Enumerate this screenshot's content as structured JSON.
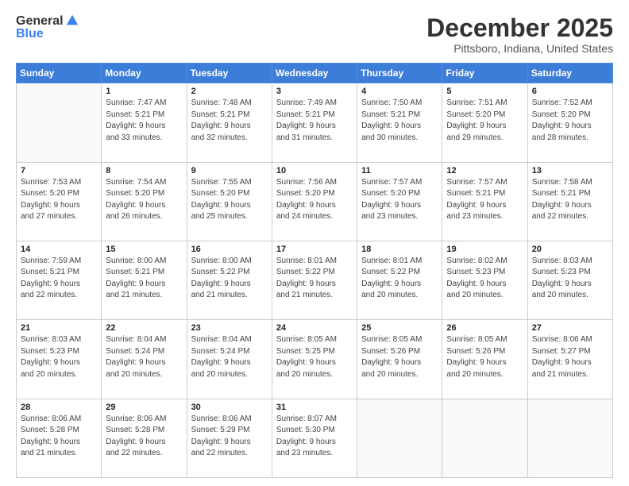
{
  "header": {
    "logo_general": "General",
    "logo_blue": "Blue",
    "month": "December 2025",
    "location": "Pittsboro, Indiana, United States"
  },
  "days_of_week": [
    "Sunday",
    "Monday",
    "Tuesday",
    "Wednesday",
    "Thursday",
    "Friday",
    "Saturday"
  ],
  "weeks": [
    [
      {
        "day": "",
        "info": ""
      },
      {
        "day": "1",
        "info": "Sunrise: 7:47 AM\nSunset: 5:21 PM\nDaylight: 9 hours\nand 33 minutes."
      },
      {
        "day": "2",
        "info": "Sunrise: 7:48 AM\nSunset: 5:21 PM\nDaylight: 9 hours\nand 32 minutes."
      },
      {
        "day": "3",
        "info": "Sunrise: 7:49 AM\nSunset: 5:21 PM\nDaylight: 9 hours\nand 31 minutes."
      },
      {
        "day": "4",
        "info": "Sunrise: 7:50 AM\nSunset: 5:21 PM\nDaylight: 9 hours\nand 30 minutes."
      },
      {
        "day": "5",
        "info": "Sunrise: 7:51 AM\nSunset: 5:20 PM\nDaylight: 9 hours\nand 29 minutes."
      },
      {
        "day": "6",
        "info": "Sunrise: 7:52 AM\nSunset: 5:20 PM\nDaylight: 9 hours\nand 28 minutes."
      }
    ],
    [
      {
        "day": "7",
        "info": "Sunrise: 7:53 AM\nSunset: 5:20 PM\nDaylight: 9 hours\nand 27 minutes."
      },
      {
        "day": "8",
        "info": "Sunrise: 7:54 AM\nSunset: 5:20 PM\nDaylight: 9 hours\nand 26 minutes."
      },
      {
        "day": "9",
        "info": "Sunrise: 7:55 AM\nSunset: 5:20 PM\nDaylight: 9 hours\nand 25 minutes."
      },
      {
        "day": "10",
        "info": "Sunrise: 7:56 AM\nSunset: 5:20 PM\nDaylight: 9 hours\nand 24 minutes."
      },
      {
        "day": "11",
        "info": "Sunrise: 7:57 AM\nSunset: 5:20 PM\nDaylight: 9 hours\nand 23 minutes."
      },
      {
        "day": "12",
        "info": "Sunrise: 7:57 AM\nSunset: 5:21 PM\nDaylight: 9 hours\nand 23 minutes."
      },
      {
        "day": "13",
        "info": "Sunrise: 7:58 AM\nSunset: 5:21 PM\nDaylight: 9 hours\nand 22 minutes."
      }
    ],
    [
      {
        "day": "14",
        "info": "Sunrise: 7:59 AM\nSunset: 5:21 PM\nDaylight: 9 hours\nand 22 minutes."
      },
      {
        "day": "15",
        "info": "Sunrise: 8:00 AM\nSunset: 5:21 PM\nDaylight: 9 hours\nand 21 minutes."
      },
      {
        "day": "16",
        "info": "Sunrise: 8:00 AM\nSunset: 5:22 PM\nDaylight: 9 hours\nand 21 minutes."
      },
      {
        "day": "17",
        "info": "Sunrise: 8:01 AM\nSunset: 5:22 PM\nDaylight: 9 hours\nand 21 minutes."
      },
      {
        "day": "18",
        "info": "Sunrise: 8:01 AM\nSunset: 5:22 PM\nDaylight: 9 hours\nand 20 minutes."
      },
      {
        "day": "19",
        "info": "Sunrise: 8:02 AM\nSunset: 5:23 PM\nDaylight: 9 hours\nand 20 minutes."
      },
      {
        "day": "20",
        "info": "Sunrise: 8:03 AM\nSunset: 5:23 PM\nDaylight: 9 hours\nand 20 minutes."
      }
    ],
    [
      {
        "day": "21",
        "info": "Sunrise: 8:03 AM\nSunset: 5:23 PM\nDaylight: 9 hours\nand 20 minutes."
      },
      {
        "day": "22",
        "info": "Sunrise: 8:04 AM\nSunset: 5:24 PM\nDaylight: 9 hours\nand 20 minutes."
      },
      {
        "day": "23",
        "info": "Sunrise: 8:04 AM\nSunset: 5:24 PM\nDaylight: 9 hours\nand 20 minutes."
      },
      {
        "day": "24",
        "info": "Sunrise: 8:05 AM\nSunset: 5:25 PM\nDaylight: 9 hours\nand 20 minutes."
      },
      {
        "day": "25",
        "info": "Sunrise: 8:05 AM\nSunset: 5:26 PM\nDaylight: 9 hours\nand 20 minutes."
      },
      {
        "day": "26",
        "info": "Sunrise: 8:05 AM\nSunset: 5:26 PM\nDaylight: 9 hours\nand 20 minutes."
      },
      {
        "day": "27",
        "info": "Sunrise: 8:06 AM\nSunset: 5:27 PM\nDaylight: 9 hours\nand 21 minutes."
      }
    ],
    [
      {
        "day": "28",
        "info": "Sunrise: 8:06 AM\nSunset: 5:28 PM\nDaylight: 9 hours\nand 21 minutes."
      },
      {
        "day": "29",
        "info": "Sunrise: 8:06 AM\nSunset: 5:28 PM\nDaylight: 9 hours\nand 22 minutes."
      },
      {
        "day": "30",
        "info": "Sunrise: 8:06 AM\nSunset: 5:29 PM\nDaylight: 9 hours\nand 22 minutes."
      },
      {
        "day": "31",
        "info": "Sunrise: 8:07 AM\nSunset: 5:30 PM\nDaylight: 9 hours\nand 23 minutes."
      },
      {
        "day": "",
        "info": ""
      },
      {
        "day": "",
        "info": ""
      },
      {
        "day": "",
        "info": ""
      }
    ]
  ]
}
